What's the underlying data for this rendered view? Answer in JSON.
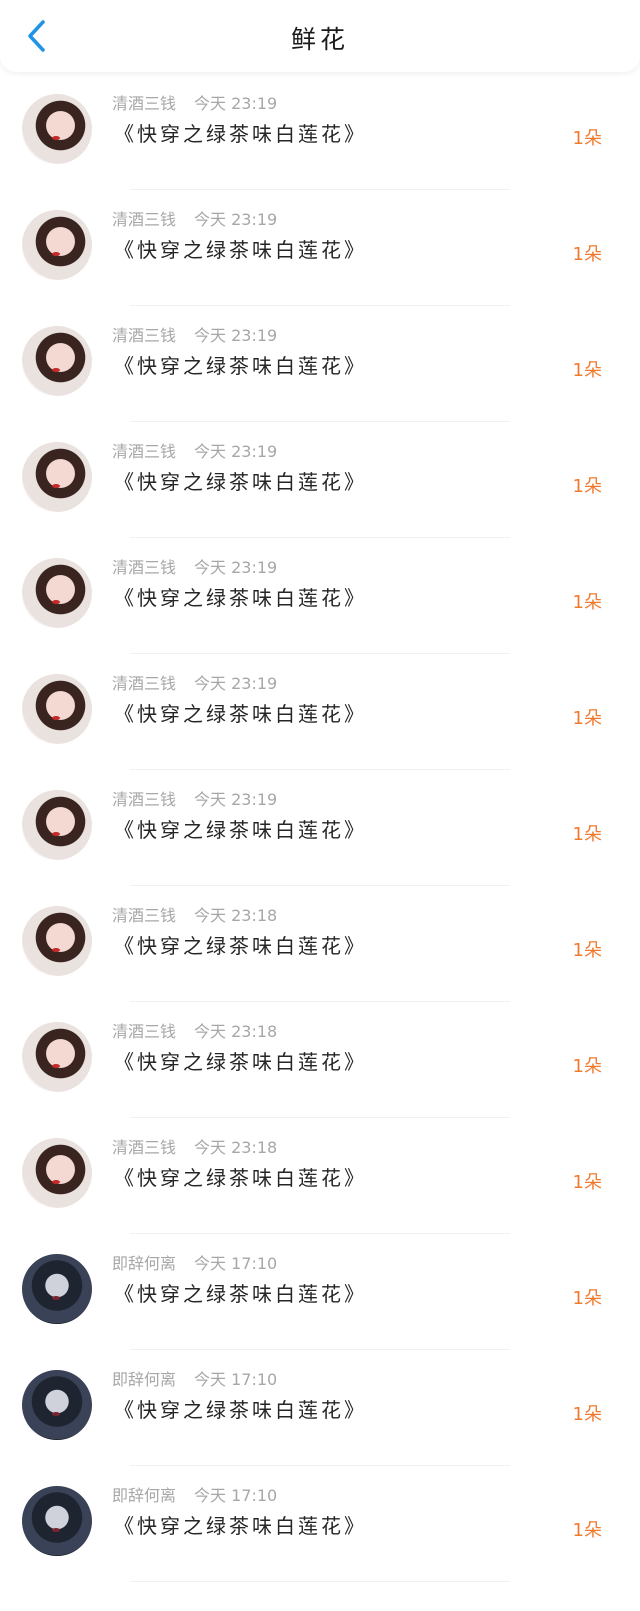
{
  "header": {
    "title": "鲜花",
    "back_icon": "chevron-left-icon",
    "accent_color": "#1e93e8"
  },
  "rows": [
    {
      "user": "清酒三钱",
      "time": "今天 23:19",
      "book": "《快穿之绿茶味白莲花》",
      "count": "1朵",
      "avatar": "light"
    },
    {
      "user": "清酒三钱",
      "time": "今天 23:19",
      "book": "《快穿之绿茶味白莲花》",
      "count": "1朵",
      "avatar": "light"
    },
    {
      "user": "清酒三钱",
      "time": "今天 23:19",
      "book": "《快穿之绿茶味白莲花》",
      "count": "1朵",
      "avatar": "light"
    },
    {
      "user": "清酒三钱",
      "time": "今天 23:19",
      "book": "《快穿之绿茶味白莲花》",
      "count": "1朵",
      "avatar": "light"
    },
    {
      "user": "清酒三钱",
      "time": "今天 23:19",
      "book": "《快穿之绿茶味白莲花》",
      "count": "1朵",
      "avatar": "light"
    },
    {
      "user": "清酒三钱",
      "time": "今天 23:19",
      "book": "《快穿之绿茶味白莲花》",
      "count": "1朵",
      "avatar": "light"
    },
    {
      "user": "清酒三钱",
      "time": "今天 23:19",
      "book": "《快穿之绿茶味白莲花》",
      "count": "1朵",
      "avatar": "light"
    },
    {
      "user": "清酒三钱",
      "time": "今天 23:18",
      "book": "《快穿之绿茶味白莲花》",
      "count": "1朵",
      "avatar": "light"
    },
    {
      "user": "清酒三钱",
      "time": "今天 23:18",
      "book": "《快穿之绿茶味白莲花》",
      "count": "1朵",
      "avatar": "light"
    },
    {
      "user": "清酒三钱",
      "time": "今天 23:18",
      "book": "《快穿之绿茶味白莲花》",
      "count": "1朵",
      "avatar": "light"
    },
    {
      "user": "即辞何离",
      "time": "今天 17:10",
      "book": "《快穿之绿茶味白莲花》",
      "count": "1朵",
      "avatar": "dark"
    },
    {
      "user": "即辞何离",
      "time": "今天 17:10",
      "book": "《快穿之绿茶味白莲花》",
      "count": "1朵",
      "avatar": "dark"
    },
    {
      "user": "即辞何离",
      "time": "今天 17:10",
      "book": "《快穿之绿茶味白莲花》",
      "count": "1朵",
      "avatar": "dark"
    }
  ],
  "colors": {
    "count": "#ef7a2e",
    "meta": "#a7a7a7"
  }
}
